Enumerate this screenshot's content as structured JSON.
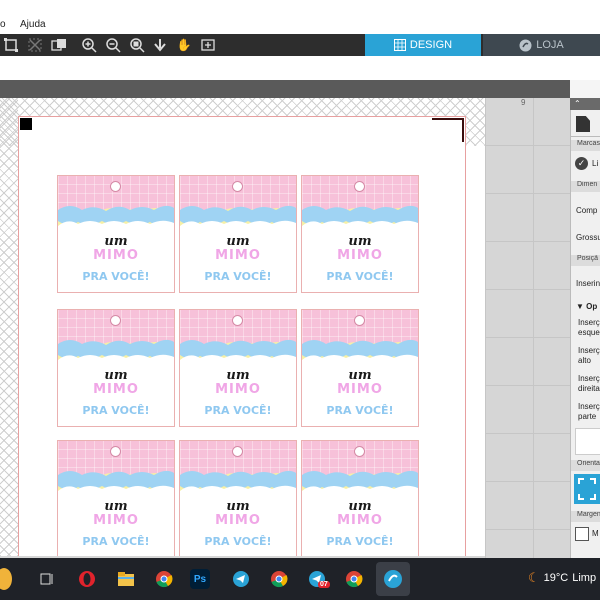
{
  "menu": {
    "item_partial": "o",
    "item_help": "Ajuda"
  },
  "tabs": {
    "design": "DESIGN",
    "store": "LOJA"
  },
  "colors": {
    "accent": "#2aa3d6",
    "pink": "#f7c1d9",
    "blue": "#9fd3f3",
    "yellow": "#f6f0a6"
  },
  "toolbar_icons": [
    "group-icon",
    "ungroup-icon",
    "replicate-icon",
    "zoom-in-icon",
    "zoom-out-icon",
    "zoom-select-icon",
    "move-down-icon",
    "pan-hand-icon",
    "fit-page-icon"
  ],
  "ruler": {
    "mark": "9"
  },
  "tag": {
    "line1": "um",
    "line2": "MIMO",
    "line3": "PRA VOCÊ!"
  },
  "panel": {
    "sec1": "Marcas",
    "line_label": "Li",
    "sec2": "Dimen",
    "comp": "Comp",
    "gross": "Grossu",
    "sec3": "Posiçã",
    "inserir": "Inserin",
    "options": "Op",
    "ins1a": "Inserç",
    "ins1b": "esque",
    "ins2a": "Inserç",
    "ins2b": "alto",
    "ins3a": "Inserç",
    "ins3b": "direita",
    "ins4a": "Inserç",
    "ins4b": "parte",
    "sec4": "Orienta",
    "sec5": "Margen",
    "m_label": "M"
  },
  "taskbar": {
    "apps": [
      "task-view",
      "opera",
      "file-explorer",
      "chrome",
      "photoshop",
      "telegram",
      "chrome",
      "telegram",
      "chrome",
      "silhouette-studio"
    ],
    "badge": "07",
    "temperature": "19°C",
    "weather_text": "Limp"
  }
}
